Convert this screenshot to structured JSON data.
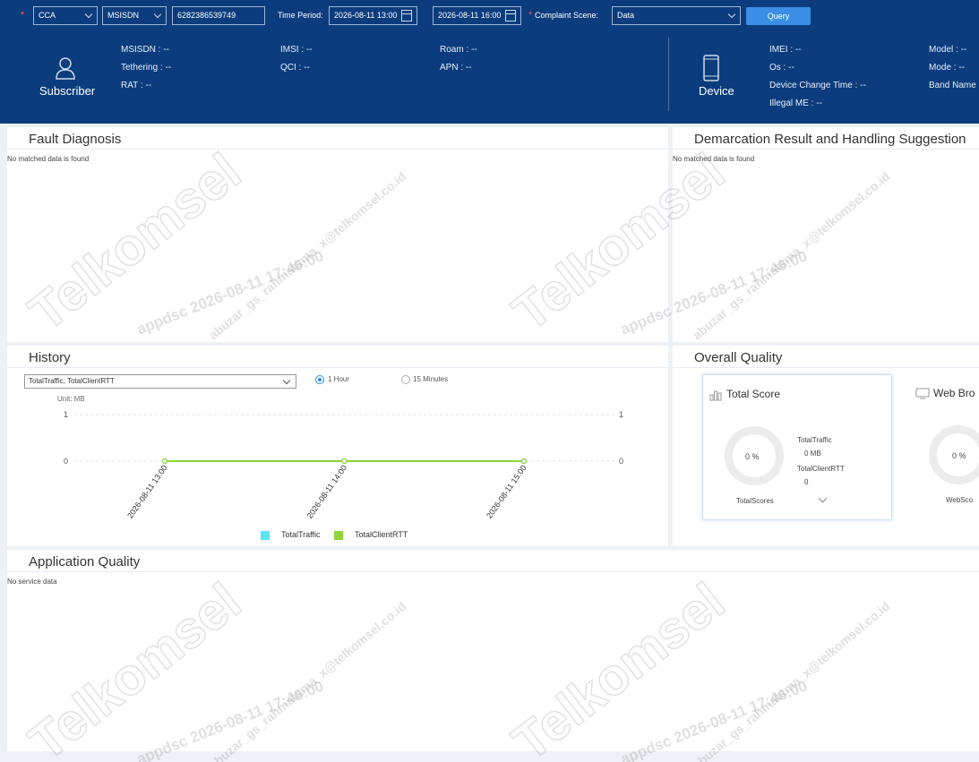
{
  "query": {
    "channel_select": "CCA",
    "id_type_select": "MSISDN",
    "msisdn_value": "6282386539749",
    "time_period_label": "Time Period:",
    "start_time": "2026-08-11 13:00",
    "end_time": "2026-08-11 16:00",
    "complaint_scene_label": "Complaint Scene:",
    "complaint_scene_value": "Data",
    "query_button": "Query"
  },
  "subscriber": {
    "label": "Subscriber",
    "fields": [
      "MSISDN : --",
      "IMSI : --",
      "Roam : --",
      "Tethering : --",
      "QCI : --",
      "APN : --",
      "RAT : --"
    ]
  },
  "device": {
    "label": "Device",
    "fields": [
      "IMEI : --",
      "Model : --",
      "Os : --",
      "Mode : --",
      "Device Change Time : --",
      "Band Name",
      "Illegal ME : --"
    ]
  },
  "fault_diagnosis": {
    "title": "Fault Diagnosis",
    "empty": "No matched data is found"
  },
  "demarcation": {
    "title": "Demarcation Result and Handling Suggestion",
    "empty": "No matched data is found"
  },
  "history": {
    "title": "History",
    "metric_select": "TotalTraffic, TotalClientRTT",
    "radio_1h": "1 Hour",
    "radio_15m": "15 Minutes",
    "unit_label": "Unit: MB",
    "legend": [
      "TotalTraffic",
      "TotalClientRTT"
    ],
    "colors": {
      "TotalTraffic": "#5ee2f5",
      "TotalClientRTT": "#8fd43c"
    }
  },
  "chart_data": {
    "type": "line",
    "categories": [
      "2026-08-11 13:00",
      "2026-08-11 14:00",
      "2026-08-11 15:00"
    ],
    "series": [
      {
        "name": "TotalTraffic",
        "values": [
          0,
          0,
          0
        ]
      },
      {
        "name": "TotalClientRTT",
        "values": [
          0,
          0,
          0
        ]
      }
    ],
    "y_ticks_left": [
      "1",
      "0"
    ],
    "y_ticks_right": [
      "1",
      "0"
    ],
    "ylim": [
      0,
      1
    ],
    "ylabel": "Unit: MB",
    "grid": true,
    "legend_position": "bottom"
  },
  "overall_quality": {
    "title": "Overall Quality",
    "total_score_title": "Total Score",
    "total_score_pct": "0 %",
    "total_traffic_label": "TotalTraffic",
    "total_traffic_value": "0 MB",
    "total_client_rtt_label": "TotalClientRTT",
    "total_client_rtt_value": "0",
    "total_scores_label": "TotalScores",
    "web_title": "Web Bro",
    "web_pct": "0 %",
    "web_score_label": "WebSco"
  },
  "application_quality": {
    "title": "Application Quality",
    "empty": "No service data"
  },
  "watermark": {
    "brand": "Telkomsel",
    "line1": "appdsc 2026-08-11 17:46:00",
    "line2": "abuzar_gs_rahmatama_x@telkomsel.co.id"
  },
  "icons": [
    "calendar-icon",
    "chevron-down-icon",
    "user-icon",
    "mobile-phone-icon",
    "bar-chart-icon",
    "monitor-icon"
  ]
}
